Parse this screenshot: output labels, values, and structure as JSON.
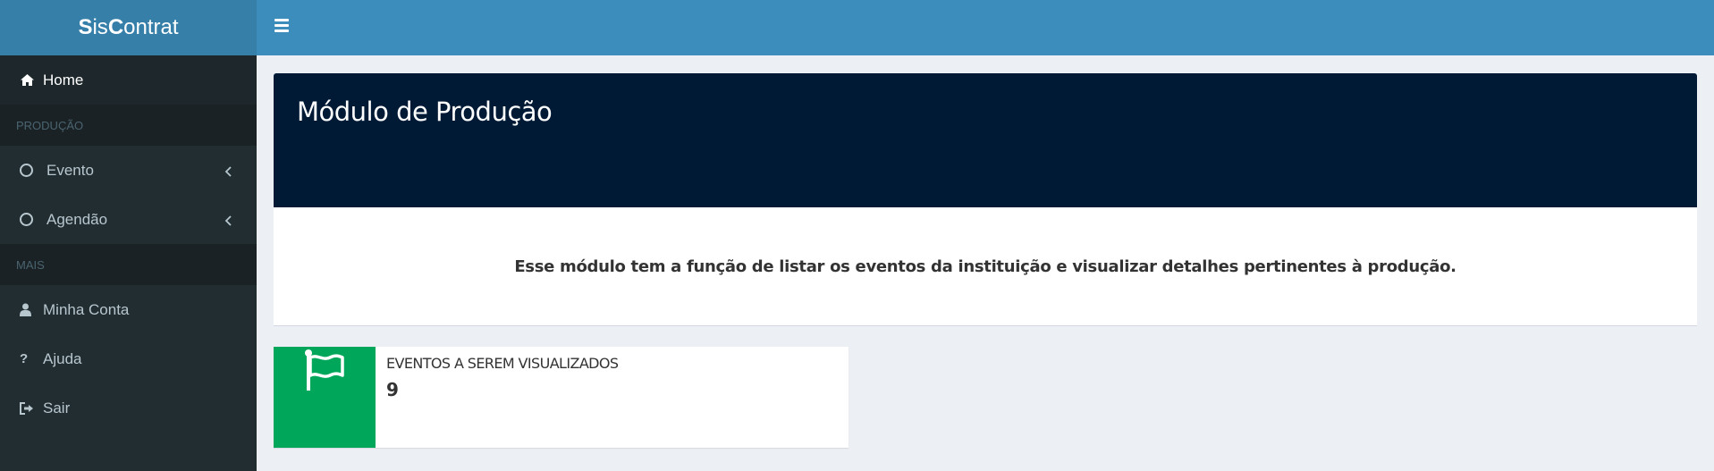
{
  "brand": {
    "part1": "S",
    "part2": "is",
    "part3": "C",
    "part4": "ontrat"
  },
  "sidebar": {
    "home_label": "Home",
    "section_producao": "PRODUÇÃO",
    "evento_label": "Evento",
    "agendao_label": "Agendão",
    "section_mais": "MAIS",
    "minha_conta_label": "Minha Conta",
    "ajuda_label": "Ajuda",
    "sair_label": "Sair"
  },
  "main": {
    "title": "Módulo de Produção",
    "description": "Esse módulo tem a função de listar os eventos da instituição e visualizar detalhes pertinentes à produção.",
    "info_box": {
      "label": "EVENTOS A SEREM VISUALIZADOS",
      "value": "9",
      "icon": "flag-icon"
    }
  },
  "colors": {
    "topbar": "#3c8dbc",
    "logo": "#367fa9",
    "sidebar": "#222d32",
    "banner": "#001a36",
    "info_icon_bg": "#00a65a"
  }
}
